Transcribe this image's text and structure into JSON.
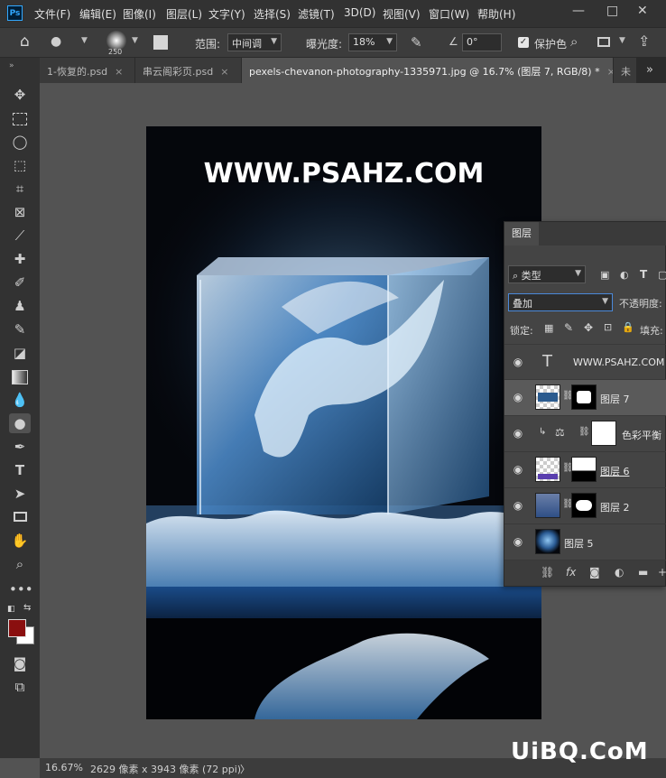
{
  "menubar": {
    "logo": "Ps",
    "items": [
      "文件(F)",
      "编辑(E)",
      "图像(I)",
      "图层(L)",
      "文字(Y)",
      "选择(S)",
      "滤镜(T)",
      "3D(D)",
      "视图(V)",
      "窗口(W)",
      "帮助(H)"
    ],
    "minimize": "—",
    "restore": "□",
    "close": "✕"
  },
  "options": {
    "brush_size": "250",
    "range_label": "范围:",
    "range_value": "中间调",
    "exposure_label": "曝光度:",
    "exposure_value": "18%",
    "angle_value": "0°",
    "protect_label": "保护色"
  },
  "tabs": [
    {
      "label": "1-恢复的.psd",
      "close": "×"
    },
    {
      "label": "串云阁彩页.psd",
      "close": "×"
    },
    {
      "label": "pexels-chevanon-photography-1335971.jpg @ 16.7% (图层 7, RGB/8) *",
      "close": "×"
    },
    {
      "label": "未",
      "close": ""
    }
  ],
  "tab_overflow": "»",
  "canvas": {
    "watermark": "WWW.PSAHZ.COM"
  },
  "status": {
    "zoom": "16.67%",
    "doc_info": "2629 像素 x 3943 像素 (72 ppi)",
    "arrow": "〉"
  },
  "layers_panel": {
    "tab_label": "图层",
    "filter_kind": "类型",
    "blend_mode": "叠加",
    "opacity_label": "不透明度:",
    "lock_label": "锁定:",
    "fill_label": "填充:",
    "layers": [
      {
        "name": "WWW.PSAHZ.COM",
        "type": "text",
        "selected": false
      },
      {
        "name": "图层 7",
        "type": "image-mask",
        "selected": true
      },
      {
        "name": "色彩平衡",
        "type": "adjustment",
        "selected": false
      },
      {
        "name": "图层 6",
        "type": "image-mask",
        "selected": false
      },
      {
        "name": "图层 2",
        "type": "image-mask",
        "selected": false
      },
      {
        "name": "图层 5",
        "type": "image",
        "selected": false
      }
    ]
  },
  "site_watermark": "UiBQ.CoM",
  "colors": {
    "foreground": "#8a0f0f",
    "background": "#ffffff",
    "accent": "#31a8ff"
  }
}
